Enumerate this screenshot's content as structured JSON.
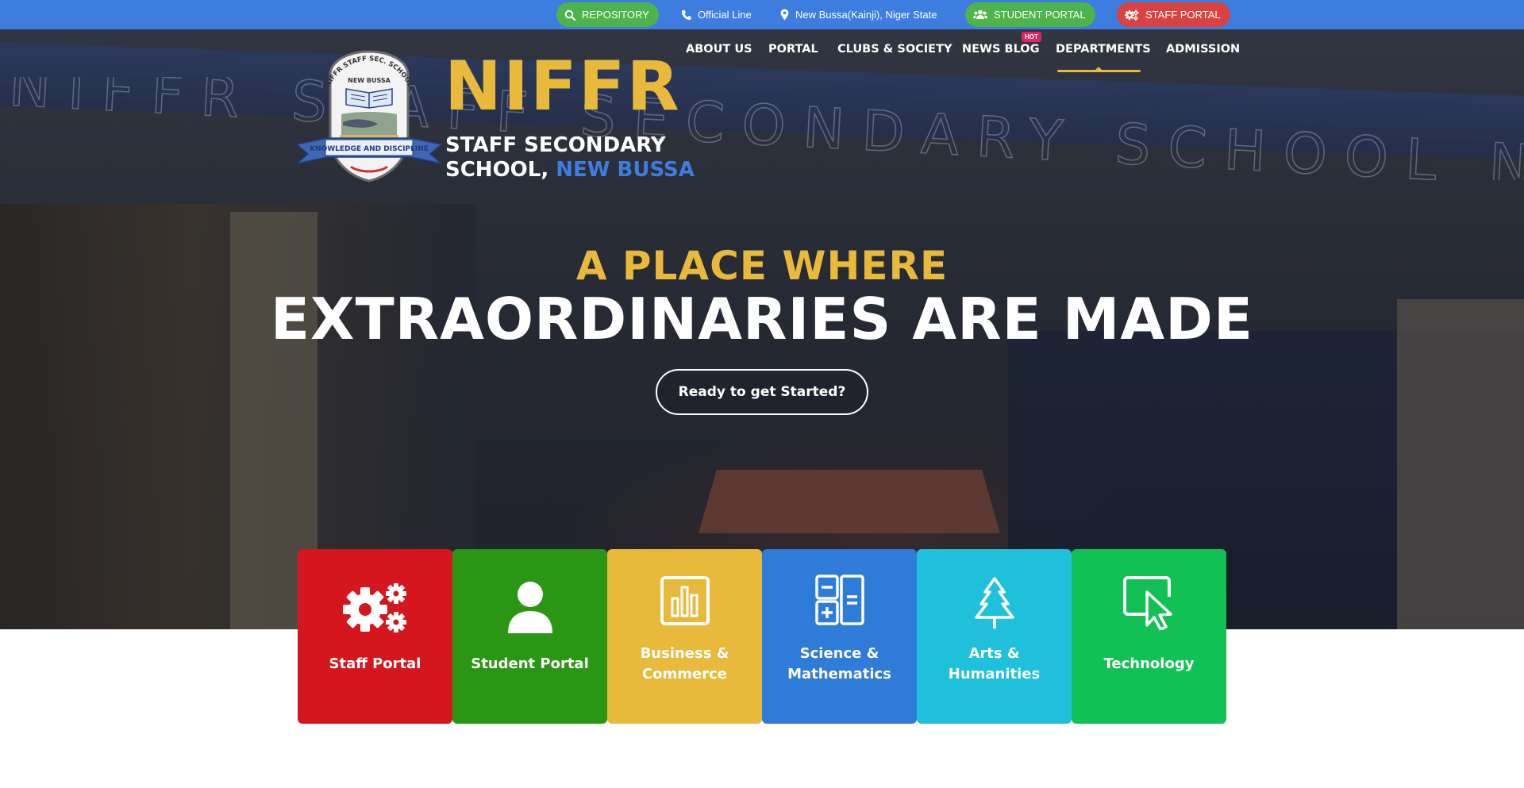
{
  "topbar": {
    "repository": "REPOSITORY",
    "official_line": "Official Line",
    "location": "New Bussa(Kainji), Niger State",
    "student_portal": "STUDENT PORTAL",
    "staff_portal": "STAFF PORTAL",
    "icons": {
      "repository": "search-icon",
      "official_line": "phone-icon",
      "location": "map-pin-icon",
      "student_portal": "users-icon",
      "staff_portal": "cogs-icon"
    },
    "colors": {
      "bar": "#3d7de0",
      "green_pill": "#4bb44b",
      "red_pill": "#d9433f"
    }
  },
  "brand": {
    "name": "NIFFR",
    "sub_line1": "STAFF SECONDARY",
    "sub_line2_prefix": "SCHOOL,",
    "sub_line2_accent": "NEW BUSSA",
    "logo": {
      "top_text": "NIFFR STAFF SEC. SCHOOL",
      "mid_text": "NEW BUSSA",
      "ribbon_text": "KNOWLEDGE AND DISCIPLINE"
    },
    "colors": {
      "gold": "#e8b93a",
      "blue": "#3d7de0"
    }
  },
  "nav": {
    "items": [
      {
        "label": "ABOUT US"
      },
      {
        "label": "PORTAL"
      },
      {
        "label": "CLUBS & SOCIETY"
      },
      {
        "label": "NEWS BLOG"
      },
      {
        "label": "DEPARTMENTS",
        "active": true
      },
      {
        "label": "ADMISSION"
      }
    ],
    "hot_badge": "HOT"
  },
  "hero": {
    "tagline_1": "A PLACE WHERE",
    "tagline_2": "EXTRAORDINARIES ARE MADE",
    "cta": "Ready to get Started?",
    "arch_text": "NIFFR STAFF SECONDARY SCHOOL NEW BUSSA"
  },
  "cards": [
    {
      "label": "Staff Portal",
      "icon": "cogs-icon",
      "color": "#d5161e"
    },
    {
      "label": "Student Portal",
      "icon": "user-icon",
      "color": "#2a9714"
    },
    {
      "label": "Business & Commerce",
      "icon": "bar-chart-icon",
      "color": "#e8b93a"
    },
    {
      "label": "Science & Mathematics",
      "icon": "calculator-icon",
      "color": "#2f7bd8"
    },
    {
      "label": "Arts & Humanities",
      "icon": "tree-icon",
      "color": "#1fc0dc"
    },
    {
      "label": "Technology",
      "icon": "cursor-icon",
      "color": "#11c154"
    }
  ]
}
